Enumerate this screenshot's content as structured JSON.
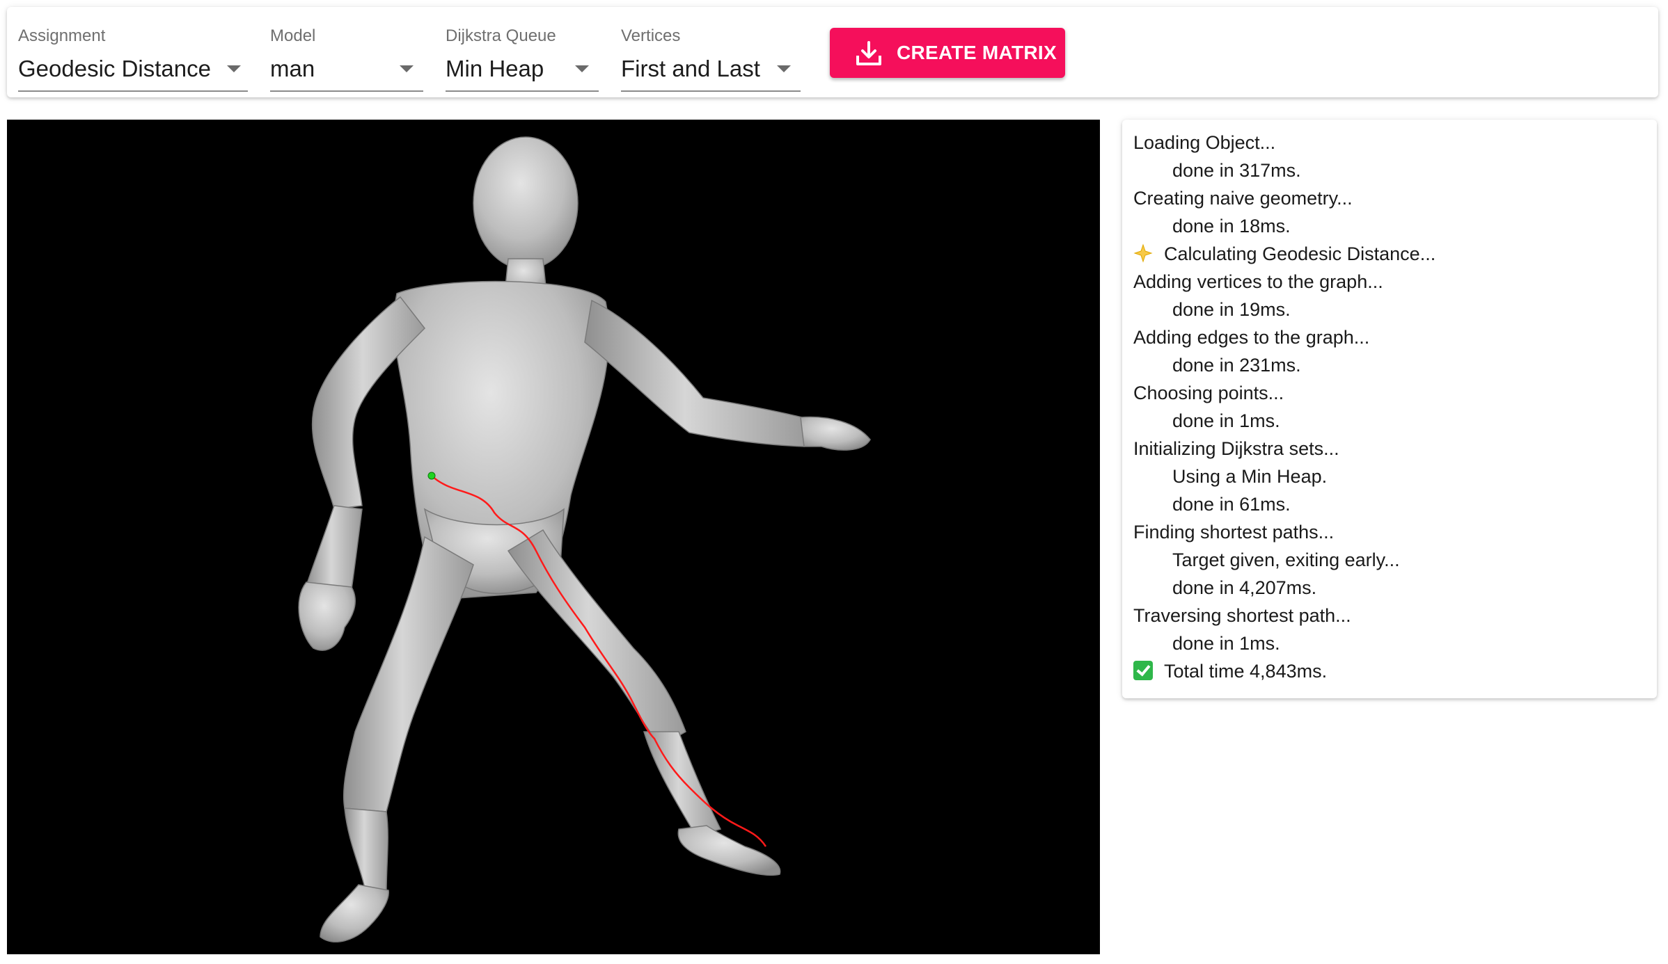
{
  "toolbar": {
    "selects": [
      {
        "label": "Assignment",
        "value": "Geodesic Distance"
      },
      {
        "label": "Model",
        "value": "man"
      },
      {
        "label": "Dijkstra Queue",
        "value": "Min Heap"
      },
      {
        "label": "Vertices",
        "value": "First and Last"
      }
    ],
    "create_button": {
      "label": "CREATE MATRIX",
      "icon": "download-icon"
    }
  },
  "viewport": {
    "background": "#000000",
    "model_color": "#c8c8c8",
    "path_color": "#ff1a1a",
    "start_marker_color": "#22d322"
  },
  "log": {
    "lines": [
      {
        "text": "Loading Object...",
        "indent": false
      },
      {
        "text": "done in 317ms.",
        "indent": true
      },
      {
        "text": "Creating naive geometry...",
        "indent": false
      },
      {
        "text": "done in 18ms.",
        "indent": true
      },
      {
        "text": "Calculating Geodesic Distance...",
        "indent": false,
        "icon": "sparkle-icon"
      },
      {
        "text": "Adding vertices to the graph...",
        "indent": false
      },
      {
        "text": "done in 19ms.",
        "indent": true
      },
      {
        "text": "Adding edges to the graph...",
        "indent": false
      },
      {
        "text": "done in 231ms.",
        "indent": true
      },
      {
        "text": "Choosing points...",
        "indent": false
      },
      {
        "text": "done in 1ms.",
        "indent": true
      },
      {
        "text": "Initializing Dijkstra sets...",
        "indent": false
      },
      {
        "text": "Using a Min Heap.",
        "indent": true
      },
      {
        "text": "done in 61ms.",
        "indent": true
      },
      {
        "text": "Finding shortest paths...",
        "indent": false
      },
      {
        "text": "Target given, exiting early...",
        "indent": true
      },
      {
        "text": "done in 4,207ms.",
        "indent": true
      },
      {
        "text": "Traversing shortest path...",
        "indent": false
      },
      {
        "text": "done in 1ms.",
        "indent": true
      },
      {
        "text": "Total time 4,843ms.",
        "indent": false,
        "icon": "check-mark-icon"
      }
    ]
  }
}
